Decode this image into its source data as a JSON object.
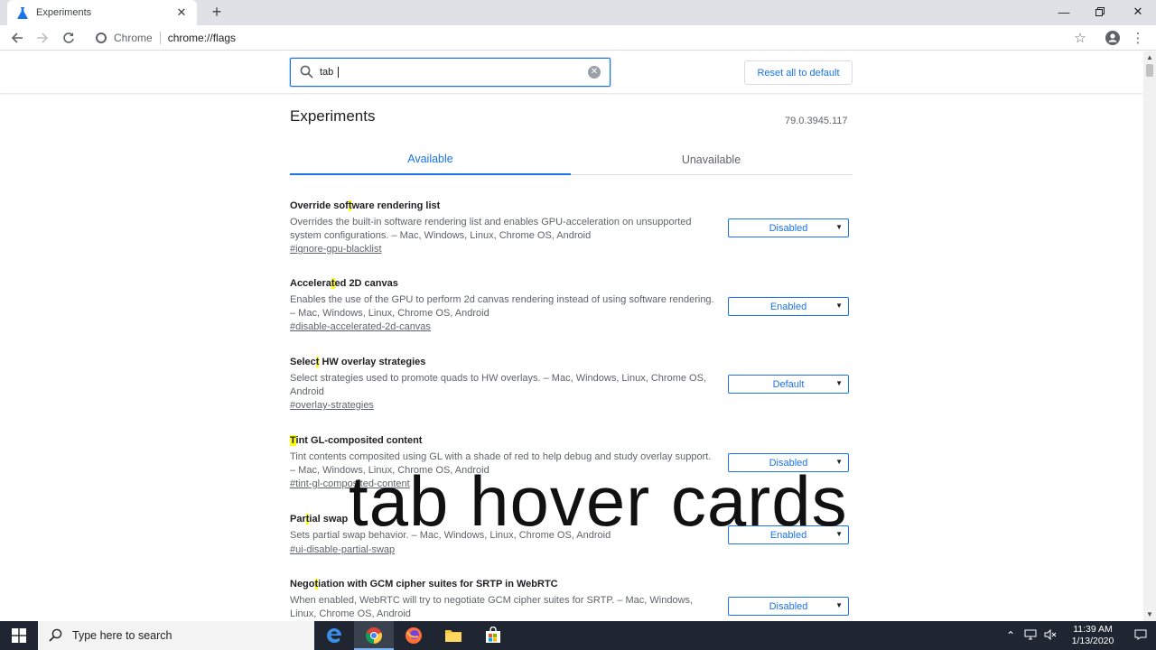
{
  "browser": {
    "tab_title": "Experiments",
    "site_chip": "Chrome",
    "url": "chrome://flags"
  },
  "header": {
    "search_value": "tab ",
    "reset_label": "Reset all to default"
  },
  "page": {
    "title": "Experiments",
    "version": "79.0.3945.117",
    "tabs": [
      {
        "label": "Available"
      },
      {
        "label": "Unavailable"
      }
    ]
  },
  "experiments": [
    {
      "name_pre": "Override sof",
      "name_hl": "t",
      "name_post": "ware rendering list",
      "desc": "Overrides the built-in software rendering list and enables GPU-acceleration on unsupported system configurations. – Mac, Windows, Linux, Chrome OS, Android",
      "link": "#ignore-gpu-blacklist",
      "value": "Disabled"
    },
    {
      "name_pre": "Accelera",
      "name_hl": "t",
      "name_post": "ed 2D canvas",
      "desc": "Enables the use of the GPU to perform 2d canvas rendering instead of using software rendering. – Mac, Windows, Linux, Chrome OS, Android",
      "link": "#disable-accelerated-2d-canvas",
      "value": "Enabled"
    },
    {
      "name_pre": "Selec",
      "name_hl": "t",
      "name_post": " HW overlay strategies",
      "desc": "Select strategies used to promote quads to HW overlays. – Mac, Windows, Linux, Chrome OS, Android",
      "link": "#overlay-strategies",
      "value": "Default"
    },
    {
      "name_pre": "",
      "name_hl": "T",
      "name_post": "int GL-composited content",
      "desc": "Tint contents composited using GL with a shade of red to help debug and study overlay support. – Mac, Windows, Linux, Chrome OS, Android",
      "link": "#tint-gl-composited-content",
      "value": "Disabled"
    },
    {
      "name_pre": "Par",
      "name_hl": "t",
      "name_post": "ial swap",
      "desc": "Sets partial swap behavior. – Mac, Windows, Linux, Chrome OS, Android",
      "link": "#ui-disable-partial-swap",
      "value": "Enabled"
    },
    {
      "name_pre": "Nego",
      "name_hl": "t",
      "name_post": "iation with GCM cipher suites for SRTP in WebRTC",
      "desc": "When enabled, WebRTC will try to negotiate GCM cipher suites for SRTP. – Mac, Windows, Linux, Chrome OS, Android",
      "link": "",
      "value": "Disabled"
    }
  ],
  "overlay_caption": "tab hover cards",
  "taskbar": {
    "search_placeholder": "Type here to search",
    "time": "11:39 AM",
    "date": "1/13/2020"
  },
  "colors": {
    "accent": "#1a73e8",
    "highlight": "#ffff00",
    "taskbar": "#1f2631"
  }
}
